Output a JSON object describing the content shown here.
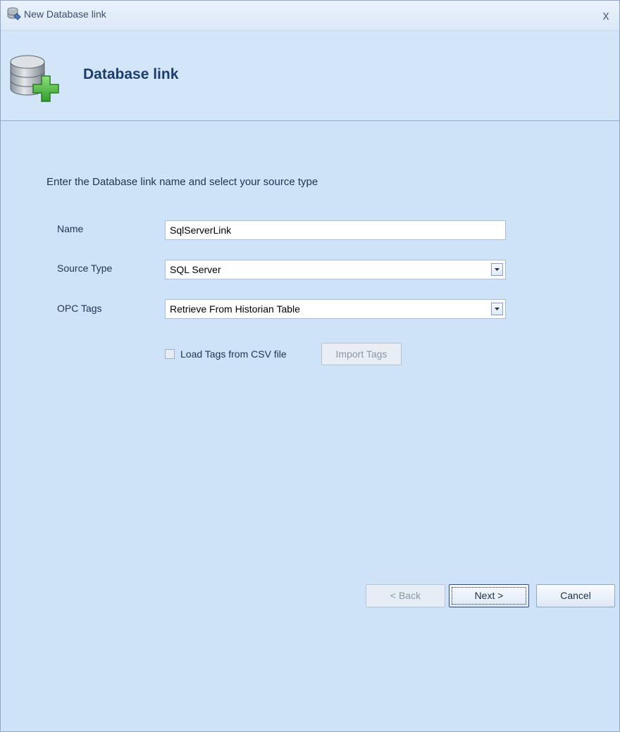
{
  "window": {
    "title": "New Database link",
    "close_glyph": "x"
  },
  "header": {
    "title": "Database link",
    "icon": "database-add-icon"
  },
  "instruction": "Enter the Database link name and select your source type",
  "form": {
    "name_label": "Name",
    "name_value": "SqlServerLink",
    "source_type_label": "Source Type",
    "source_type_value": "SQL Server",
    "opc_tags_label": "OPC Tags",
    "opc_tags_value": "Retrieve From Historian Table",
    "load_csv_label": "Load Tags from CSV file",
    "load_csv_checked": false,
    "import_tags_label": "Import Tags"
  },
  "buttons": {
    "back": "< Back",
    "next": "Next >",
    "cancel": "Cancel"
  },
  "colors": {
    "background": "#cfe3f8",
    "title_text": "#1c3d6c"
  }
}
